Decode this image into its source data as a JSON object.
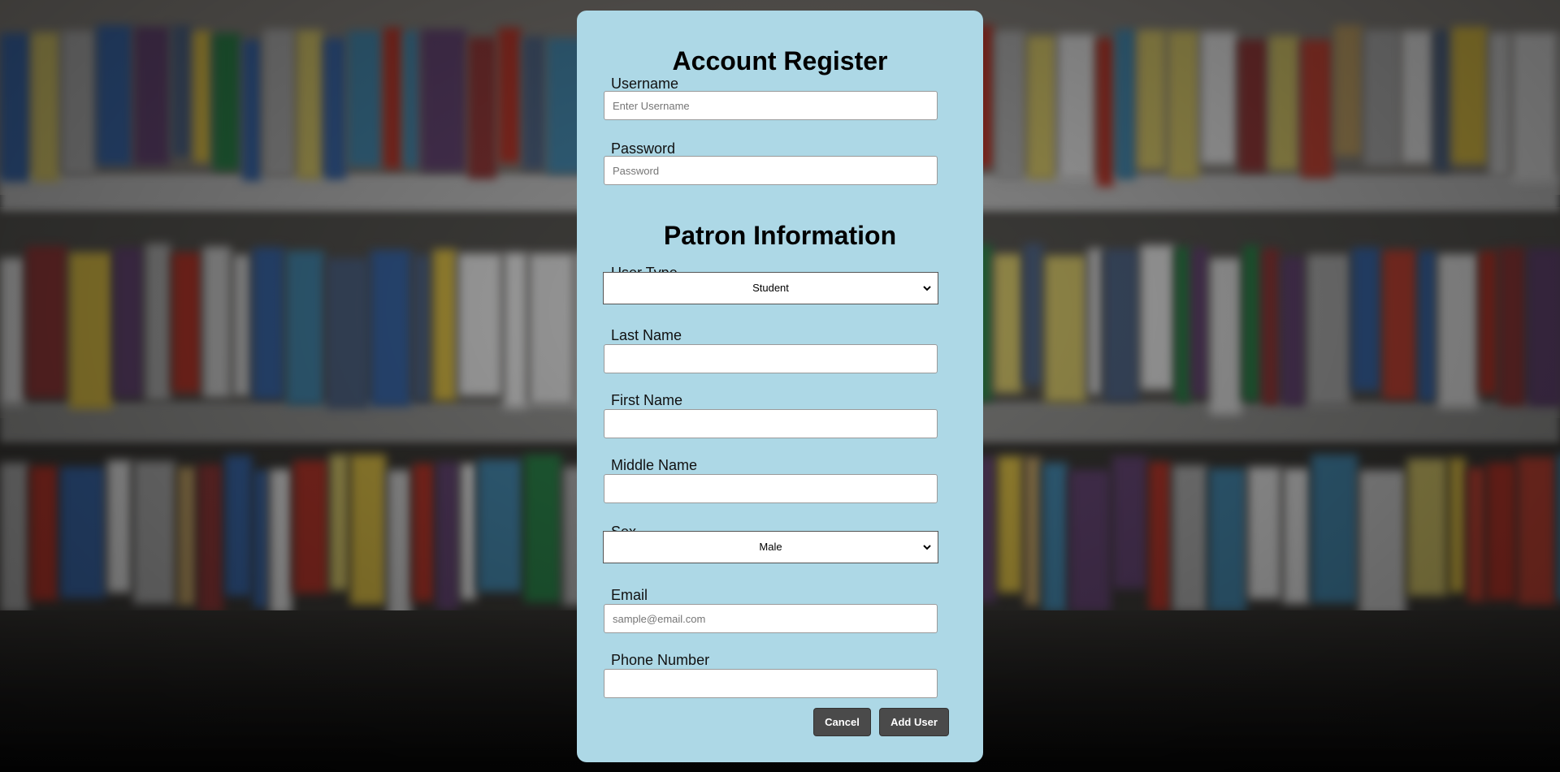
{
  "account_section": {
    "title": "Account Register",
    "username_label": "Username",
    "username_placeholder": "Enter Username",
    "password_label": "Password",
    "password_placeholder": "Password"
  },
  "patron_section": {
    "title": "Patron Information",
    "user_type_label": "User Type",
    "user_type_value": "Student",
    "last_name_label": "Last Name",
    "first_name_label": "First Name",
    "middle_name_label": "Middle Name",
    "sex_label": "Sex",
    "sex_value": "Male",
    "email_label": "Email",
    "email_placeholder": "sample@email.com",
    "phone_label": "Phone Number"
  },
  "actions": {
    "cancel_label": "Cancel",
    "add_user_label": "Add User"
  },
  "theme": {
    "panel_color": "#add8e6",
    "button_color": "#4a4a4a"
  },
  "icons": {
    "dropdown": "chevron-down-icon"
  }
}
